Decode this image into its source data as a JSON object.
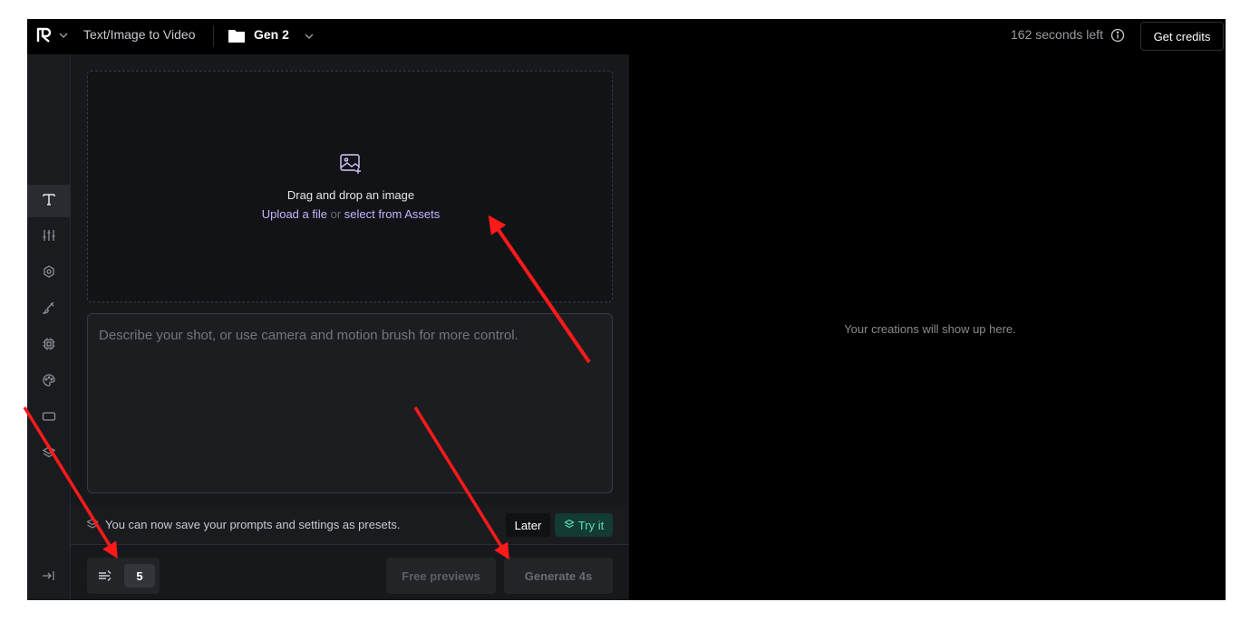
{
  "header": {
    "mode_title": "Text/Image to Video",
    "project_name": "Gen 2",
    "seconds_left": "162 seconds left",
    "get_credits_label": "Get credits"
  },
  "sidebar": {
    "items": [
      {
        "icon": "text-icon",
        "active": true
      },
      {
        "icon": "sliders-icon"
      },
      {
        "icon": "camera-icon"
      },
      {
        "icon": "brush-icon"
      },
      {
        "icon": "chip-icon"
      },
      {
        "icon": "palette-icon"
      },
      {
        "icon": "aspect-ratio-icon"
      },
      {
        "icon": "layers-icon"
      }
    ],
    "collapse_icon": "collapse-icon"
  },
  "dropzone": {
    "title": "Drag and drop an image",
    "upload_link": "Upload a file",
    "or_text": "or",
    "assets_link": "select from Assets"
  },
  "prompt": {
    "placeholder": "Describe your shot, or use camera and motion brush for more control."
  },
  "presets_banner": {
    "text": "You can now save your prompts and settings as presets.",
    "later_label": "Later",
    "try_label": "Try it"
  },
  "controls": {
    "motion_value": "5",
    "free_previews_label": "Free previews",
    "generate_label": "Generate 4s"
  },
  "output": {
    "empty_message": "Your creations will show up here."
  },
  "colors": {
    "accent_link": "#c5b3ff",
    "try_it_green": "#5ae0bb",
    "annotation_arrow": "#ff1a1a"
  }
}
